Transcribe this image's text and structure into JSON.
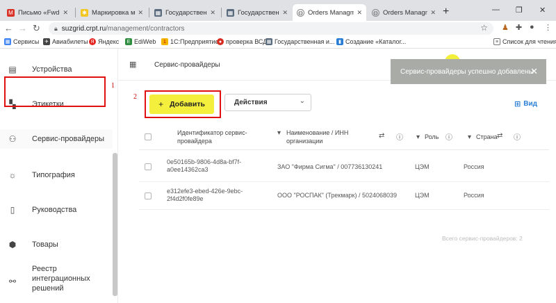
{
  "browser": {
    "tabs": [
      {
        "label": "Письмо «Fwd: Иде",
        "icon": "gmail-icon",
        "color": "#d93025"
      },
      {
        "label": "Маркировка моло",
        "icon": "tab-favicon-icon",
        "color": "#f3c623"
      },
      {
        "label": "Государственная и",
        "icon": "tab-favicon-icon",
        "color": "#5a6b7d"
      },
      {
        "label": "Государственная и",
        "icon": "tab-favicon-icon",
        "color": "#5a6b7d"
      },
      {
        "label": "Orders Managment",
        "icon": "globe-icon",
        "color": "#777777"
      },
      {
        "label": "Orders Managment",
        "icon": "globe-icon",
        "color": "#777777"
      }
    ],
    "active_tab_index": 4,
    "address": {
      "host": "suzgrid.crpt.ru",
      "path": "/management/contractors"
    },
    "bookmarks": [
      {
        "label": "Сервисы",
        "color": "#4285f4"
      },
      {
        "label": "Авиабилеты",
        "color": "#444444"
      },
      {
        "label": "Яндекс",
        "color": "#e52620"
      },
      {
        "label": "EdiWeb",
        "color": "#2f8f3f"
      },
      {
        "label": "1С:Предприятие",
        "color": "#f2b500"
      },
      {
        "label": "проверка ВСД",
        "color": "#d62d20"
      },
      {
        "label": "Государственная и...",
        "color": "#5a6b7d"
      },
      {
        "label": "Создание «Каталог...",
        "color": "#2a7fd4"
      }
    ],
    "reading_list": "Список для чтения"
  },
  "sidebar": {
    "items": [
      {
        "label": "Устройства",
        "icon": "devices-icon"
      },
      {
        "label": "Этикетки",
        "icon": "labels-icon"
      },
      {
        "label": "Сервис-провайдеры",
        "icon": "service-provider-icon"
      },
      {
        "label": "Типография",
        "icon": "printing-icon"
      },
      {
        "label": "Руководства",
        "icon": "document-icon"
      },
      {
        "label": "Товары",
        "icon": "box-icon"
      },
      {
        "label": "Реестр интеграционных решений",
        "icon": "network-icon"
      }
    ],
    "active_index": 2
  },
  "annotations": {
    "mark1": "1",
    "mark2": "2"
  },
  "header": {
    "title": "Сервис-провайдеры"
  },
  "toast": {
    "message": "Сервис-провайдеры успешно добавлены"
  },
  "toolbar": {
    "add_label": "Добавить",
    "add_plus": "+",
    "actions_label": "Действия",
    "view_label": "Вид"
  },
  "table": {
    "columns": [
      {
        "label": "Идентификатор сервис-провайдера"
      },
      {
        "label": "Наименование / ИНН организации"
      },
      {
        "label": "Роль"
      },
      {
        "label": "Страна"
      }
    ],
    "rows": [
      {
        "id": "0e50165b-9806-4d8a-bf7f-a0ee14362ca3",
        "name": "ЗАО \"Фирма Сигма\" / 007736130241",
        "role": "ЦЭМ",
        "country": "Россия"
      },
      {
        "id": "e312efe3-ebed-426e-9ebc-2f4d2f0fe89e",
        "name": "ООО \"РОСПАК\" (Трекмарк) / 5024068039",
        "role": "ЦЭМ",
        "country": "Россия"
      }
    ],
    "total_label": "Всего сервис-провайдеров: 2"
  }
}
